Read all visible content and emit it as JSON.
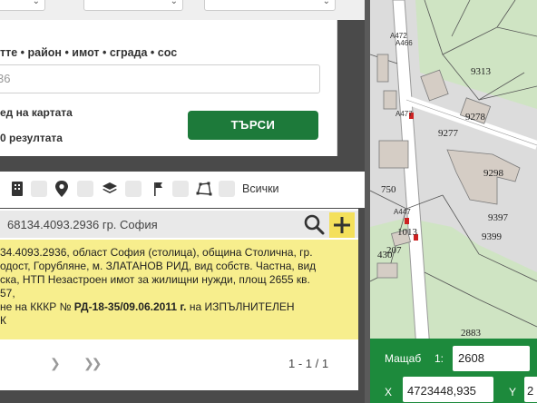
{
  "search": {
    "hint": "тте • район • имот • сграда • сос",
    "query_value": "36",
    "show_on_map_label": "ед на картата",
    "results_label": "0 резултата",
    "search_button": "ТЪРСИ"
  },
  "filters": {
    "all_label": "Всички",
    "icons": [
      "building-icon",
      "location-pin-icon",
      "layers-icon",
      "flag-icon",
      "polygon-icon"
    ]
  },
  "result": {
    "title": "68134.4093.2936 гр. София",
    "lines": [
      "34.4093.2936, област София (столица), община Столична, гр.",
      "одост, Горубляне, м. ЗЛАТАНОВ РИД, вид собств. Частна, вид",
      "ска, НТП Незастроен имот за жилищни нужди, площ 2655 кв.",
      "57,"
    ],
    "line5_pre": "не на КККР № ",
    "line5_bold": "РД-18-35/09.06.2011 г.",
    "line5_post": " на ИЗПЪЛНИТЕЛЕН",
    "line6": "К",
    "pager": "1 - 1 / 1"
  },
  "map": {
    "scale_label": "Мащаб",
    "scale_prefix": "1:",
    "scale_value": "2608",
    "x_label": "X",
    "x_value": "4723448,935",
    "y_label": "Y",
    "y_value": "2",
    "parcel_labels": [
      "9313",
      "9278",
      "9277",
      "9298",
      "9397",
      "9399",
      "2883",
      "1013",
      "207",
      "430",
      "750",
      "A466",
      "A472",
      "A477",
      "A447"
    ],
    "colors": {
      "map_green": "#cfe4c3",
      "road": "#ffffff",
      "building": "#d8d0c8",
      "accent_green": "#1d8a3c",
      "result_yellow": "#f7ee8d"
    }
  }
}
